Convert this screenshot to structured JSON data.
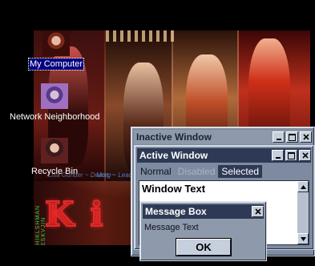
{
  "desktop": {
    "icons": [
      {
        "label": "My Computer",
        "icon": "my-computer-icon"
      },
      {
        "label": "Network Neighborhood",
        "icon": "network-neighborhood-icon"
      },
      {
        "label": "Recycle Bin",
        "icon": "recycle-bin-icon"
      }
    ],
    "wallpaper": {
      "logo_text": "Ki",
      "credit_left": "Lisa Gunder ~ Drums ~",
      "credit_right": "Morg ~ Lead Vo",
      "vertical_text": "SHIKLSHMAN JESKVJIN"
    }
  },
  "colors": {
    "active_title": "#2e3a55",
    "inactive_title": "#8e99ab",
    "window_face": "#7d8aa0",
    "selection": "#2e3a55"
  },
  "inactive_window": {
    "title": "Inactive Window",
    "controls": [
      "minimize-icon",
      "maximize-icon",
      "close-icon"
    ]
  },
  "active_window": {
    "title": "Active Window",
    "controls": [
      "minimize-icon",
      "maximize-icon",
      "close-icon"
    ],
    "menu": {
      "normal": "Normal",
      "disabled": "Disabled",
      "selected": "Selected"
    },
    "window_text": "Window Text"
  },
  "message_box": {
    "title": "Message Box",
    "text": "Message Text",
    "ok_label": "OK"
  }
}
